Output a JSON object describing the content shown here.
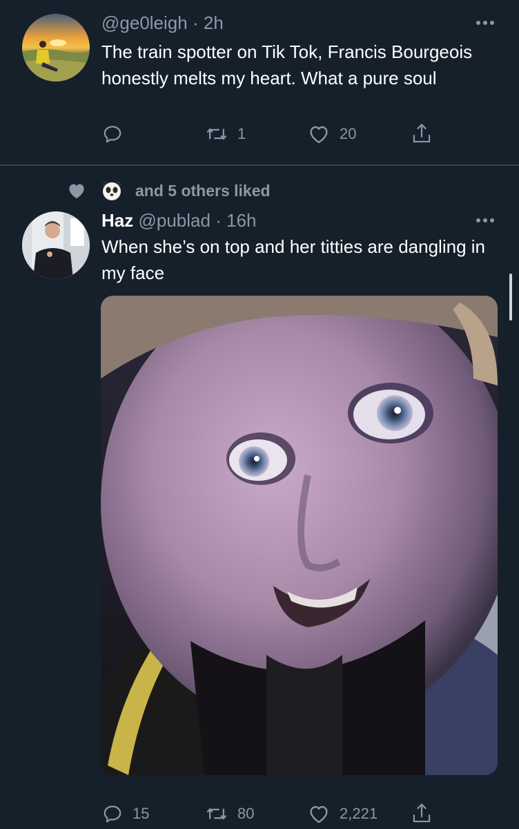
{
  "tweet1": {
    "handle": "@ge0leigh",
    "sep": "·",
    "time": "2h",
    "text": "The train spotter on Tik Tok, Francis Bourgeois honestly melts my heart. What a pure soul",
    "reply_count": "",
    "retweet_count": "1",
    "like_count": "20"
  },
  "tweet2": {
    "social_context": "and 5 others liked",
    "name": "Haz",
    "handle": "@publad",
    "sep": "·",
    "time": "16h",
    "text": "When she’s on top and her titties are dangling in my face",
    "reply_count": "15",
    "retweet_count": "80",
    "like_count": "2,221"
  },
  "icons": {
    "more": "more-horizontal-icon",
    "reply": "reply-icon",
    "retweet": "retweet-icon",
    "like": "heart-icon",
    "share": "share-icon",
    "liked_heart": "heart-filled-icon",
    "panda": "panda-avatar-icon"
  },
  "colors": {
    "background": "#15202b",
    "secondary_text": "#8b98a5",
    "divider": "#38444d"
  }
}
